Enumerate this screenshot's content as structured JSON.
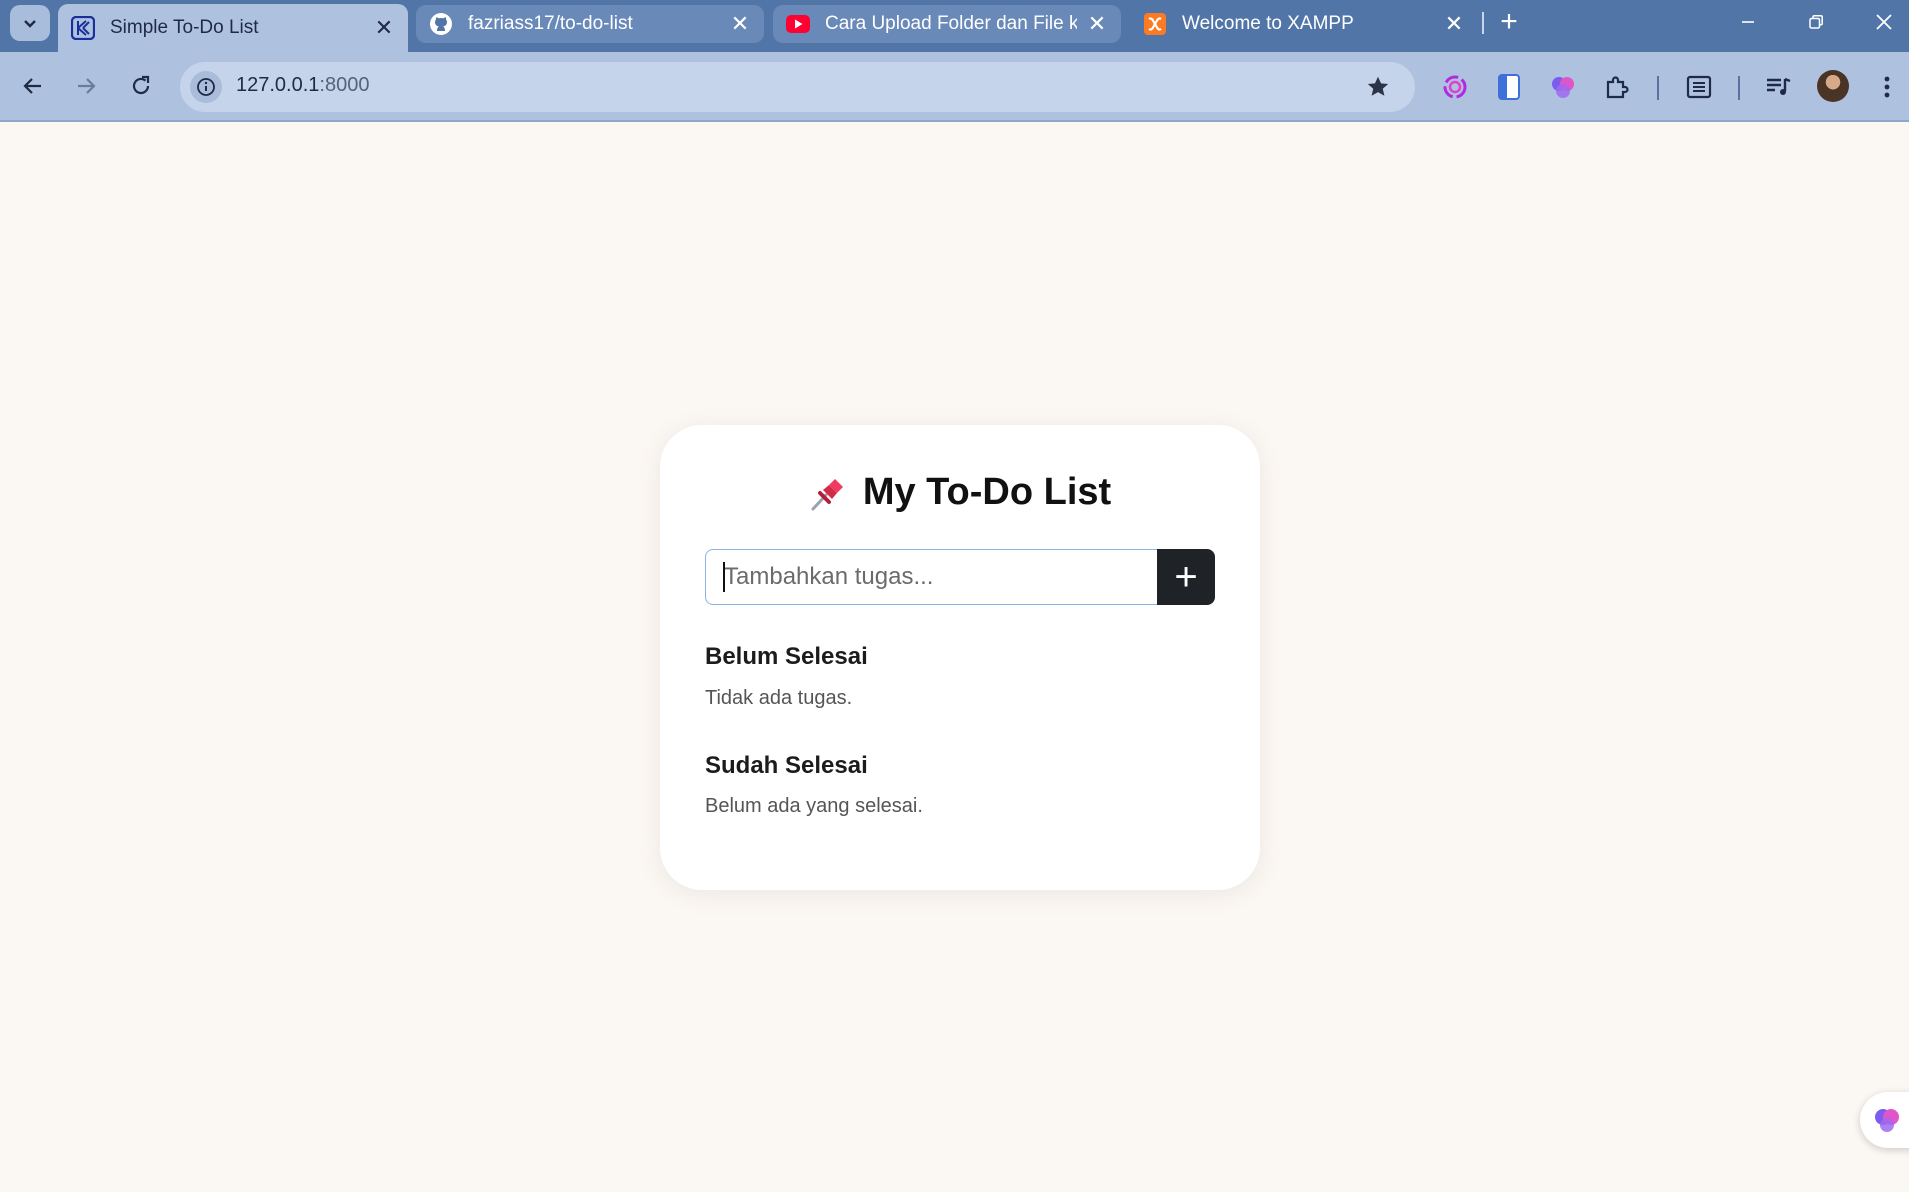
{
  "browser": {
    "tabs": [
      {
        "title": "Simple To-Do List",
        "icon": "kodein-icon",
        "active": true
      },
      {
        "title": "fazriass17/to-do-list",
        "icon": "github-icon",
        "active": false
      },
      {
        "title": "Cara Upload Folder dan File ke",
        "icon": "youtube-icon",
        "active": false
      },
      {
        "title": "Welcome to XAMPP",
        "icon": "xampp-icon",
        "active": false
      }
    ],
    "address": {
      "host": "127.0.0.1",
      "port": ":8000"
    },
    "colors": {
      "tabstrip": "#5275a8",
      "toolbar": "#aec2e0"
    }
  },
  "app": {
    "title": "My To-Do List",
    "title_icon": "pushpin-icon",
    "input_placeholder": "Tambahkan tugas...",
    "add_button_label": "+",
    "sections": [
      {
        "heading": "Belum Selesai",
        "empty_text": "Tidak ada tugas."
      },
      {
        "heading": "Sudah Selesai",
        "empty_text": "Belum ada yang selesai."
      }
    ],
    "colors": {
      "page_bg": "#fbf7f3",
      "card_bg": "#ffffff",
      "button_bg": "#1f2328"
    }
  }
}
